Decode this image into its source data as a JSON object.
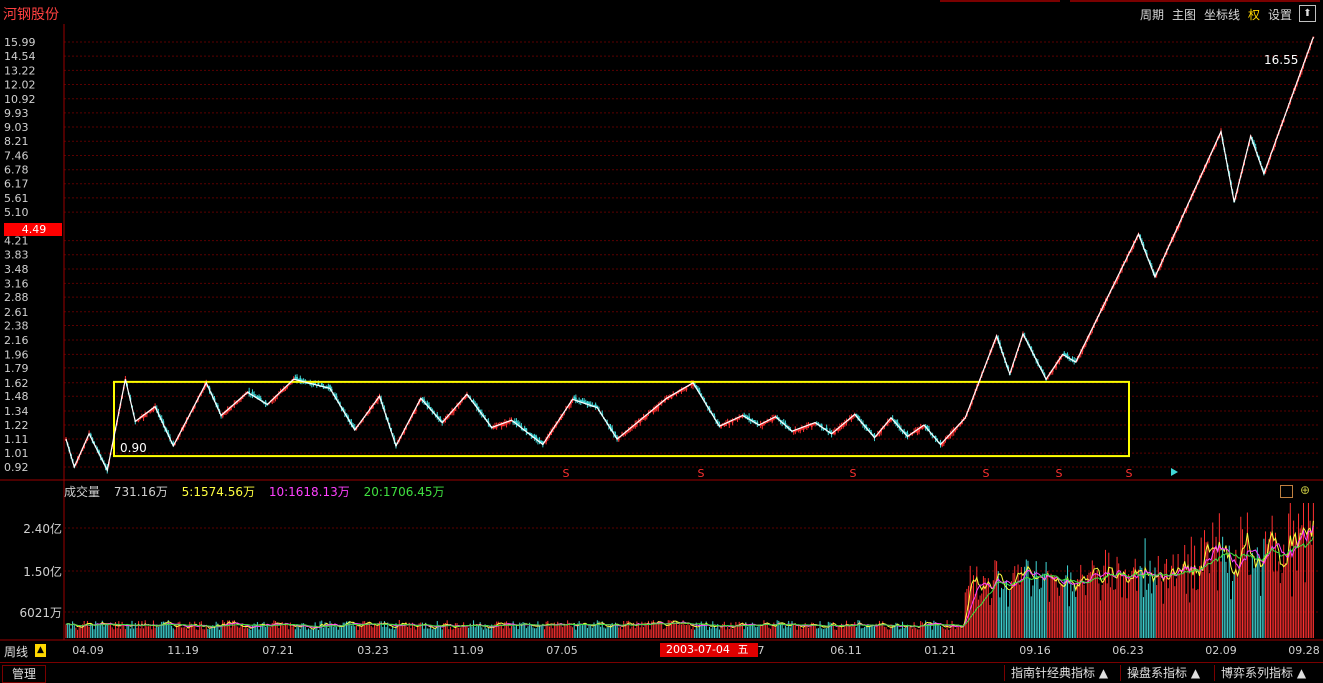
{
  "app": {
    "title": "河钢股份"
  },
  "toolbar": {
    "period": "周期",
    "main": "主图",
    "coord": "坐标线",
    "right": "权",
    "settings": "设置",
    "up": "⬆"
  },
  "current_price": "4.49",
  "annotations": {
    "high": "16.55",
    "low": "0.90"
  },
  "volume": {
    "name": "成交量",
    "current": "731.16万",
    "ma5": "5:1574.56万",
    "ma10": "10:1618.13万",
    "ma20": "20:1706.45万"
  },
  "period_label": "周线",
  "cursor": {
    "date": "2003-07-04",
    "weekday": "五"
  },
  "bottom": {
    "manage": "管理",
    "tabs": [
      "指南针经典指标 ▲",
      "操盘系指标 ▲",
      "博弈系列指标 ▲"
    ]
  },
  "colors": {
    "up": "#ff3030",
    "down": "#40d8d8",
    "box": "#ffff00",
    "zigzag": "#ffffff",
    "signal": "#ff3030"
  },
  "chart_data": {
    "type": "candlestick",
    "y_scale": "log",
    "y_ticks": [
      "15.99",
      "14.54",
      "13.22",
      "12.02",
      "10.92",
      "9.93",
      "9.03",
      "8.21",
      "7.46",
      "6.78",
      "6.17",
      "5.61",
      "5.10",
      "4.21",
      "3.83",
      "3.48",
      "3.16",
      "2.88",
      "2.61",
      "2.38",
      "2.16",
      "1.96",
      "1.79",
      "1.62",
      "1.48",
      "1.34",
      "1.22",
      "1.11",
      "1.01",
      "0.92"
    ],
    "x_ticks": [
      "04.09",
      "11.19",
      "07.21",
      "03.23",
      "11.09",
      "07.05",
      "02.",
      "7",
      "06.11",
      "01.21",
      "09.16",
      "06.23",
      "02.09",
      "09.28"
    ],
    "zigzag": [
      [
        0,
        1.11
      ],
      [
        5,
        0.92
      ],
      [
        14,
        1.15
      ],
      [
        25,
        0.9
      ],
      [
        36,
        1.66
      ],
      [
        42,
        1.25
      ],
      [
        54,
        1.38
      ],
      [
        65,
        1.06
      ],
      [
        85,
        1.62
      ],
      [
        94,
        1.3
      ],
      [
        110,
        1.52
      ],
      [
        122,
        1.4
      ],
      [
        138,
        1.66
      ],
      [
        160,
        1.56
      ],
      [
        175,
        1.18
      ],
      [
        190,
        1.48
      ],
      [
        200,
        1.06
      ],
      [
        215,
        1.46
      ],
      [
        228,
        1.24
      ],
      [
        243,
        1.5
      ],
      [
        258,
        1.2
      ],
      [
        270,
        1.26
      ],
      [
        289,
        1.07
      ],
      [
        307,
        1.45
      ],
      [
        322,
        1.37
      ],
      [
        334,
        1.11
      ],
      [
        364,
        1.46
      ],
      [
        380,
        1.62
      ],
      [
        396,
        1.21
      ],
      [
        410,
        1.3
      ],
      [
        420,
        1.22
      ],
      [
        430,
        1.29
      ],
      [
        440,
        1.17
      ],
      [
        454,
        1.24
      ],
      [
        464,
        1.15
      ],
      [
        478,
        1.31
      ],
      [
        490,
        1.12
      ],
      [
        500,
        1.28
      ],
      [
        510,
        1.13
      ],
      [
        520,
        1.22
      ],
      [
        530,
        1.07
      ],
      [
        545,
        1.28
      ],
      [
        564,
        2.22
      ],
      [
        572,
        1.72
      ],
      [
        580,
        2.25
      ],
      [
        594,
        1.66
      ],
      [
        604,
        1.96
      ],
      [
        612,
        1.86
      ],
      [
        650,
        4.4
      ],
      [
        660,
        3.3
      ],
      [
        700,
        8.76
      ],
      [
        708,
        5.45
      ],
      [
        718,
        8.5
      ],
      [
        726,
        6.6
      ],
      [
        756,
        16.55
      ]
    ],
    "box": {
      "price_low": 0.99,
      "price_high": 1.63
    },
    "volume_ticks": [
      "2.40亿",
      "1.50亿",
      "6021万"
    ],
    "signal_marks": [
      "S",
      "S",
      "S",
      "S",
      "S",
      "S"
    ]
  }
}
